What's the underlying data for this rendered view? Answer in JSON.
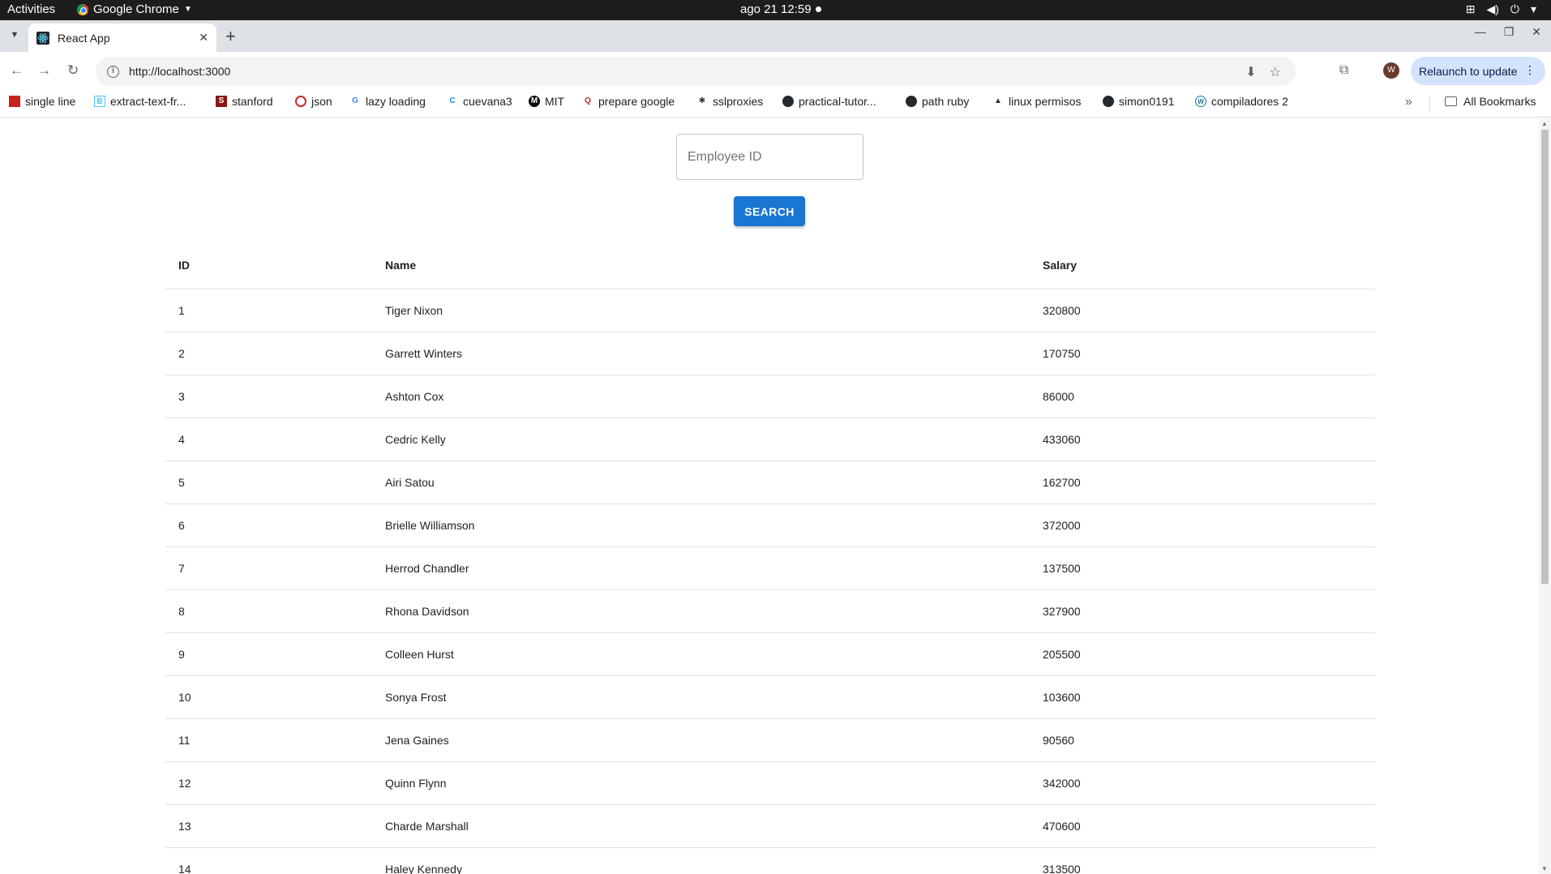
{
  "system_bar": {
    "activities": "Activities",
    "app_name": "Google Chrome",
    "clock": "ago 21  12:59"
  },
  "browser": {
    "tab_title": "React App",
    "url": "http://localhost:3000",
    "relaunch_label": "Relaunch to update",
    "avatar_letter": "W"
  },
  "bookmarks": {
    "items": [
      {
        "label": "single line",
        "icon": "pdf-icon"
      },
      {
        "label": "extract-text-fr...",
        "icon": "doc-icon"
      },
      {
        "label": "stanford",
        "icon": "stanford-icon"
      },
      {
        "label": "json",
        "icon": "json-icon"
      },
      {
        "label": "lazy loading",
        "icon": "google-icon"
      },
      {
        "label": "cuevana3",
        "icon": "cuevana-icon"
      },
      {
        "label": "MIT",
        "icon": "mit-icon"
      },
      {
        "label": "prepare google",
        "icon": "quora-icon"
      },
      {
        "label": "sslproxies",
        "icon": "sslproxies-icon"
      },
      {
        "label": "practical-tutor...",
        "icon": "github-icon"
      },
      {
        "label": "path ruby",
        "icon": "github-icon"
      },
      {
        "label": "linux permisos",
        "icon": "linux-icon"
      },
      {
        "label": "simon0191",
        "icon": "github-icon"
      },
      {
        "label": "compiladores 2",
        "icon": "wordpress-icon"
      }
    ],
    "all_bookmarks": "All Bookmarks"
  },
  "search": {
    "placeholder": "Employee ID",
    "button_label": "SEARCH"
  },
  "table": {
    "headers": {
      "id": "ID",
      "name": "Name",
      "salary": "Salary"
    },
    "rows": [
      {
        "id": "1",
        "name": "Tiger Nixon",
        "salary": "320800"
      },
      {
        "id": "2",
        "name": "Garrett Winters",
        "salary": "170750"
      },
      {
        "id": "3",
        "name": "Ashton Cox",
        "salary": "86000"
      },
      {
        "id": "4",
        "name": "Cedric Kelly",
        "salary": "433060"
      },
      {
        "id": "5",
        "name": "Airi Satou",
        "salary": "162700"
      },
      {
        "id": "6",
        "name": "Brielle Williamson",
        "salary": "372000"
      },
      {
        "id": "7",
        "name": "Herrod Chandler",
        "salary": "137500"
      },
      {
        "id": "8",
        "name": "Rhona Davidson",
        "salary": "327900"
      },
      {
        "id": "9",
        "name": "Colleen Hurst",
        "salary": "205500"
      },
      {
        "id": "10",
        "name": "Sonya Frost",
        "salary": "103600"
      },
      {
        "id": "11",
        "name": "Jena Gaines",
        "salary": "90560"
      },
      {
        "id": "12",
        "name": "Quinn Flynn",
        "salary": "342000"
      },
      {
        "id": "13",
        "name": "Charde Marshall",
        "salary": "470600"
      },
      {
        "id": "14",
        "name": "Haley Kennedy",
        "salary": "313500"
      }
    ]
  },
  "colors": {
    "primary": "#1976d2",
    "tabstrip": "#dee1e6",
    "relaunch_bg": "#d3e3fd"
  }
}
